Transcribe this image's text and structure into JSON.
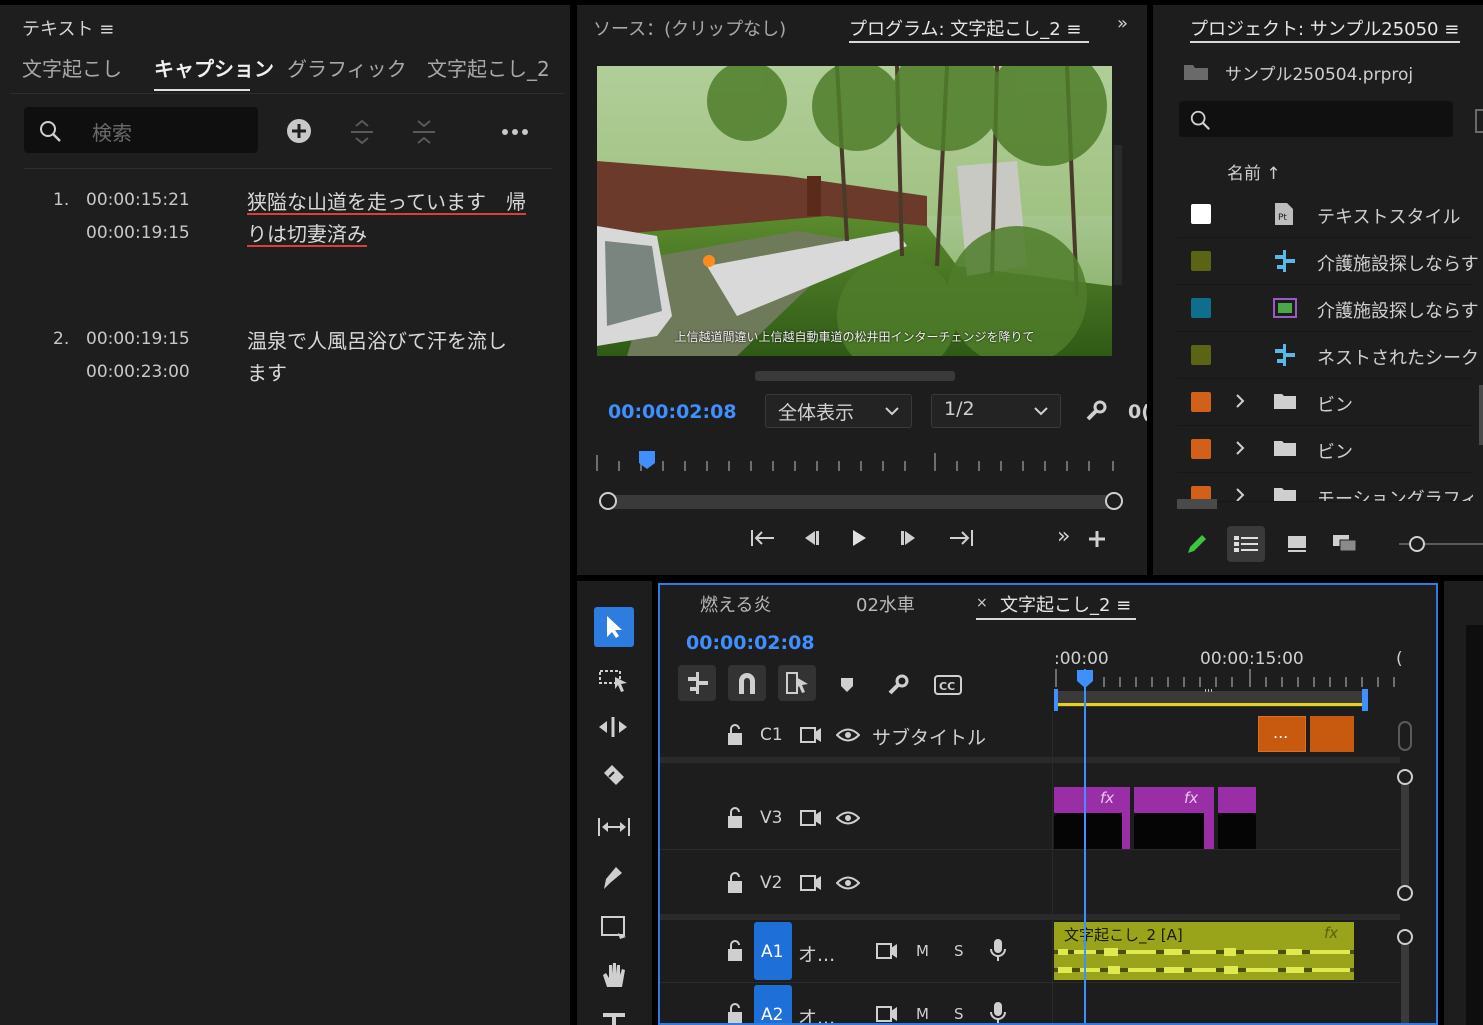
{
  "text_panel": {
    "title": "テキスト",
    "tabs": [
      {
        "label": "文字起こし"
      },
      {
        "label": "キャプション"
      },
      {
        "label": "グラフィック"
      },
      {
        "label": "文字起こし_2"
      }
    ],
    "search_placeholder": "検索",
    "captions": [
      {
        "num": "1.",
        "start": "00:00:15:21",
        "end": "00:00:19:15",
        "line1": "狭隘な山道を走っています　帰",
        "line2": "りは切妻済み"
      },
      {
        "num": "2.",
        "start": "00:00:19:15",
        "end": "00:00:23:00",
        "line1": "温泉で人風呂浴びて汗を流し",
        "line2": "ます"
      }
    ]
  },
  "program_monitor": {
    "source_tab": "ソース：(クリップなし)",
    "program_tab": "プログラム: 文字起こし_2",
    "video_subtitle": "上信越道間違い上信越自動車道の松井田インターチェンジを降りて",
    "timecode": "00:00:02:08",
    "zoom_select": "全体表示",
    "resolution_select": "1/2",
    "duration_fragment": "0("
  },
  "project_panel": {
    "title": "プロジェクト: サンプル25050",
    "file": "サンプル250504.prproj",
    "column_name": "名前",
    "items": [
      {
        "label": "テキストスタイル",
        "color": "#ffffff",
        "icon": "text-style-icon",
        "expand": false
      },
      {
        "label": "介護施設探しならす",
        "color": "#5a6414",
        "icon": "sequence-icon",
        "expand": false
      },
      {
        "label": "介護施設探しならす",
        "color": "#0e6e8c",
        "icon": "clip-icon",
        "expand": false
      },
      {
        "label": "ネストされたシーク",
        "color": "#5a6414",
        "icon": "sequence-icon",
        "expand": false
      },
      {
        "label": "ビン",
        "color": "#d0601a",
        "icon": "folder-icon",
        "expand": true
      },
      {
        "label": "ビン",
        "color": "#d0601a",
        "icon": "folder-icon",
        "expand": true
      },
      {
        "label": "モーショングラフィ",
        "color": "#d0601a",
        "icon": "folder-icon",
        "expand": true
      }
    ]
  },
  "timeline": {
    "tabs": [
      {
        "label": "燃える炎"
      },
      {
        "label": "02水車"
      },
      {
        "label": "文字起こし_2"
      }
    ],
    "close_glyph": "×",
    "timecode": "00:00:02:08",
    "ruler": {
      "start": ":00:00",
      "mid": "00:00:15:00",
      "end": "("
    },
    "tracks": {
      "c1": {
        "id": "C1",
        "name": "サブタイトル"
      },
      "v3": {
        "id": "V3"
      },
      "v2": {
        "id": "V2"
      },
      "a1": {
        "id": "A1",
        "name": "オ...",
        "m": "M",
        "s": "S"
      },
      "a2": {
        "id": "A2",
        "name": "オ...",
        "m": "M",
        "s": "S"
      }
    },
    "caption_clip_text": "...",
    "audio_clip_label": "文字起こし_2 [A]",
    "fx_label": "fx",
    "work_area_marks": "'''",
    "colors": {
      "accent": "#2d7de0",
      "video_clip": "#9a2ea6",
      "audio_clip": "#9aa41a",
      "caption_clip": "#c85a10"
    }
  }
}
